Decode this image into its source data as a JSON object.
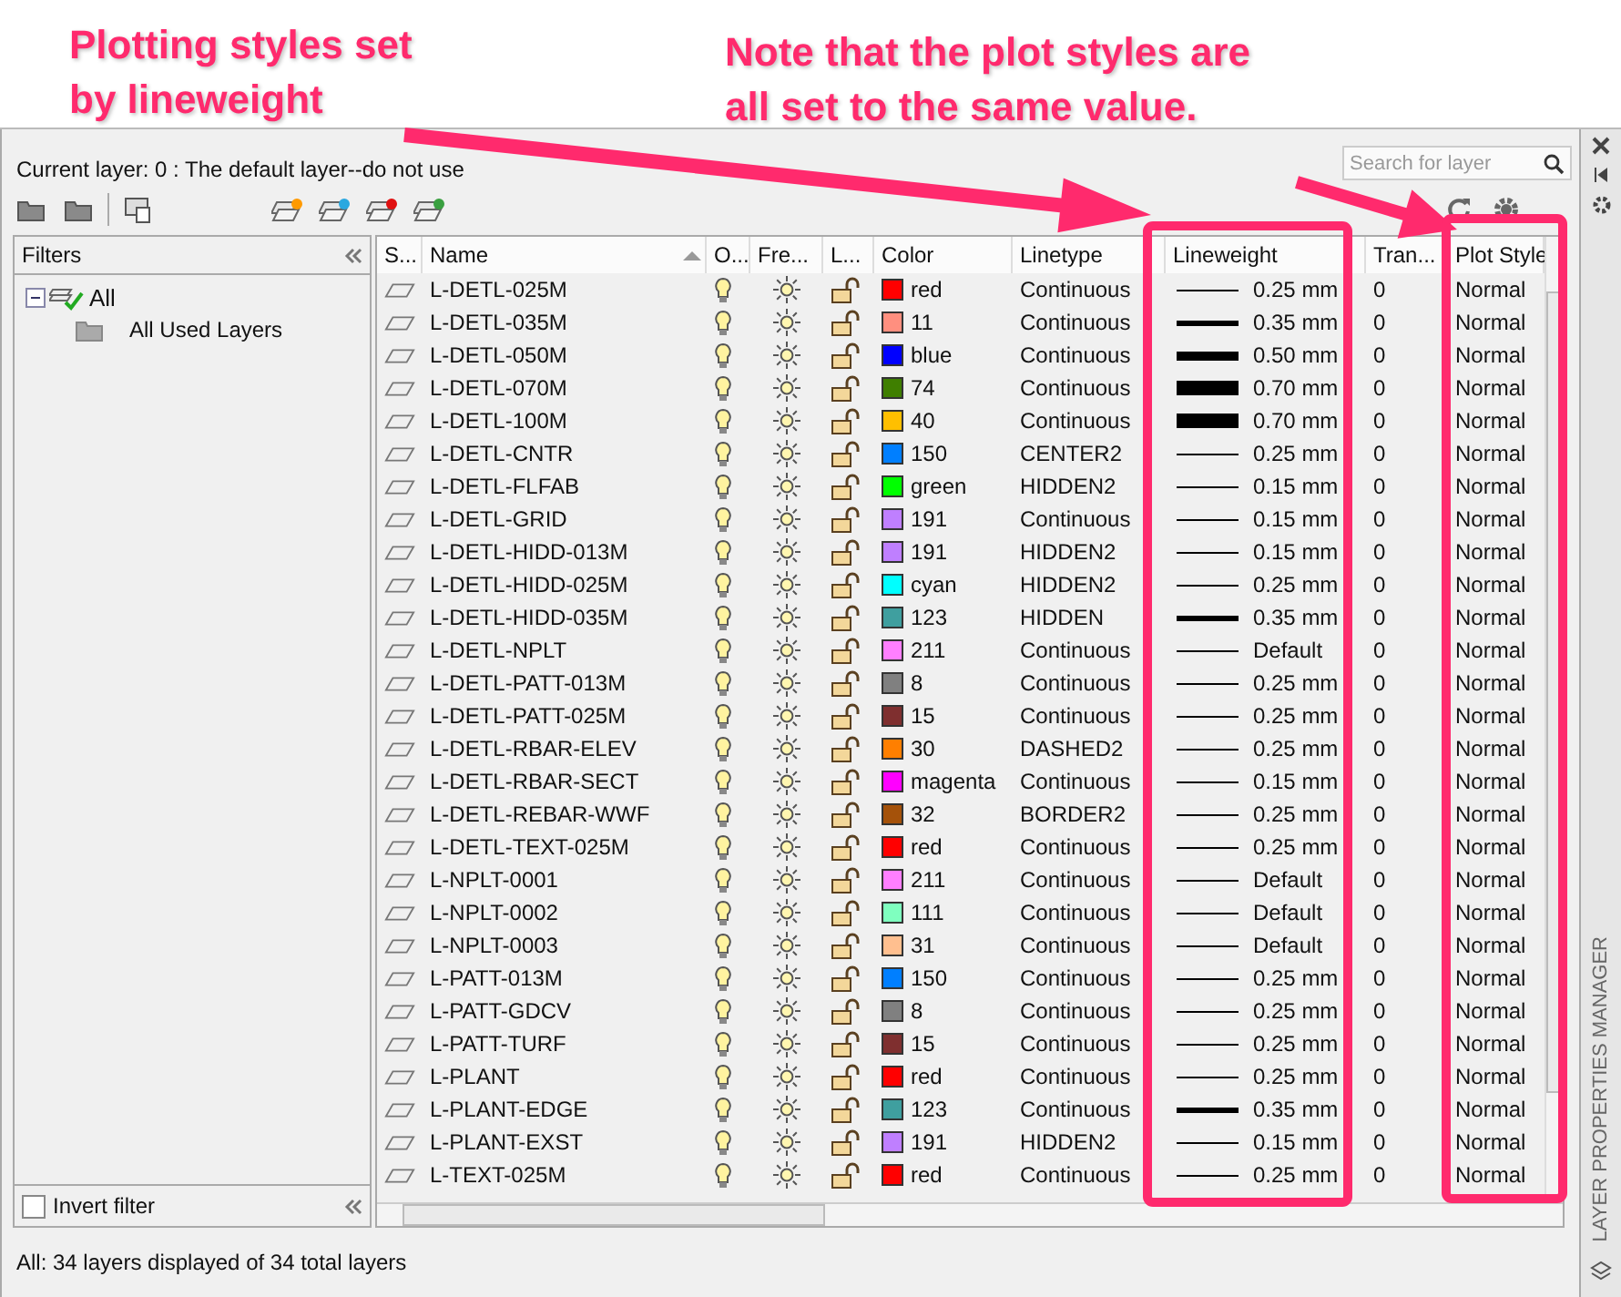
{
  "annotations": [
    {
      "text": "Plotting styles set\nby lineweight"
    },
    {
      "text": "Note that the plot styles are\nall set to the same value."
    }
  ],
  "current_layer": "Current layer: 0 : The default layer--do not use",
  "search": {
    "placeholder": "Search for layer"
  },
  "filters": {
    "title": "Filters",
    "tree": [
      {
        "label": "All",
        "expanded": true,
        "children": [
          {
            "label": "All Used Layers"
          }
        ]
      }
    ],
    "invert_filter": {
      "label": "Invert filter",
      "checked": false
    }
  },
  "table": {
    "columns": [
      {
        "label": "S..."
      },
      {
        "label": "Name",
        "sorted": true
      },
      {
        "label": "O..."
      },
      {
        "label": "Fre..."
      },
      {
        "label": "L..."
      },
      {
        "label": "Color"
      },
      {
        "label": "Linetype"
      },
      {
        "label": "Lineweight"
      },
      {
        "label": "Tran..."
      },
      {
        "label": "Plot Style"
      }
    ],
    "rows": [
      {
        "name": "L-DETL-025M",
        "on": true,
        "frozen": false,
        "locked": false,
        "color": "#ff0000",
        "color_name": "red",
        "linetype": "Continuous",
        "kind": "thin",
        "lineweight": "0.25 mm",
        "transparency": "0",
        "plot_style": "Normal"
      },
      {
        "name": "L-DETL-035M",
        "on": true,
        "frozen": false,
        "locked": false,
        "color": "#ff8f7f",
        "color_name": "11",
        "linetype": "Continuous",
        "kind": "medium",
        "lineweight": "0.35 mm",
        "transparency": "0",
        "plot_style": "Normal"
      },
      {
        "name": "L-DETL-050M",
        "on": true,
        "frozen": false,
        "locked": false,
        "color": "#0000ff",
        "color_name": "blue",
        "linetype": "Continuous",
        "kind": "bold",
        "lineweight": "0.50 mm",
        "transparency": "0",
        "plot_style": "Normal"
      },
      {
        "name": "L-DETL-070M",
        "on": true,
        "frozen": false,
        "locked": false,
        "color": "#3f7f00",
        "color_name": "74",
        "linetype": "Continuous",
        "kind": "heavy",
        "lineweight": "0.70 mm",
        "transparency": "0",
        "plot_style": "Normal"
      },
      {
        "name": "L-DETL-100M",
        "on": true,
        "frozen": false,
        "locked": false,
        "color": "#ffbf00",
        "color_name": "40",
        "linetype": "Continuous",
        "kind": "heavy",
        "lineweight": "0.70 mm",
        "transparency": "0",
        "plot_style": "Normal"
      },
      {
        "name": "L-DETL-CNTR",
        "on": true,
        "frozen": false,
        "locked": false,
        "color": "#007fff",
        "color_name": "150",
        "linetype": "CENTER2",
        "kind": "thin",
        "lineweight": "0.25 mm",
        "transparency": "0",
        "plot_style": "Normal"
      },
      {
        "name": "L-DETL-FLFAB",
        "on": true,
        "frozen": false,
        "locked": false,
        "color": "#00ff00",
        "color_name": "green",
        "linetype": "HIDDEN2",
        "kind": "thin",
        "lineweight": "0.15 mm",
        "transparency": "0",
        "plot_style": "Normal"
      },
      {
        "name": "L-DETL-GRID",
        "on": true,
        "frozen": false,
        "locked": false,
        "color": "#bf7fff",
        "color_name": "191",
        "linetype": "Continuous",
        "kind": "thin",
        "lineweight": "0.15 mm",
        "transparency": "0",
        "plot_style": "Normal"
      },
      {
        "name": "L-DETL-HIDD-013M",
        "on": true,
        "frozen": false,
        "locked": false,
        "color": "#bf7fff",
        "color_name": "191",
        "linetype": "HIDDEN2",
        "kind": "thin",
        "lineweight": "0.15 mm",
        "transparency": "0",
        "plot_style": "Normal"
      },
      {
        "name": "L-DETL-HIDD-025M",
        "on": true,
        "frozen": false,
        "locked": false,
        "color": "#00ffff",
        "color_name": "cyan",
        "linetype": "HIDDEN2",
        "kind": "thin",
        "lineweight": "0.25 mm",
        "transparency": "0",
        "plot_style": "Normal"
      },
      {
        "name": "L-DETL-HIDD-035M",
        "on": true,
        "frozen": false,
        "locked": false,
        "color": "#3f9f9f",
        "color_name": "123",
        "linetype": "HIDDEN",
        "kind": "medium",
        "lineweight": "0.35 mm",
        "transparency": "0",
        "plot_style": "Normal"
      },
      {
        "name": "L-DETL-NPLT",
        "on": true,
        "frozen": false,
        "locked": false,
        "color": "#ff7fff",
        "color_name": "211",
        "linetype": "Continuous",
        "kind": "thin",
        "lineweight": "Default",
        "transparency": "0",
        "plot_style": "Normal"
      },
      {
        "name": "L-DETL-PATT-013M",
        "on": true,
        "frozen": false,
        "locked": false,
        "color": "#808080",
        "color_name": "8",
        "linetype": "Continuous",
        "kind": "thin",
        "lineweight": "0.25 mm",
        "transparency": "0",
        "plot_style": "Normal"
      },
      {
        "name": "L-DETL-PATT-025M",
        "on": true,
        "frozen": false,
        "locked": false,
        "color": "#7f2f2f",
        "color_name": "15",
        "linetype": "Continuous",
        "kind": "thin",
        "lineweight": "0.25 mm",
        "transparency": "0",
        "plot_style": "Normal"
      },
      {
        "name": "L-DETL-RBAR-ELEV",
        "on": true,
        "frozen": false,
        "locked": false,
        "color": "#ff7f00",
        "color_name": "30",
        "linetype": "DASHED2",
        "kind": "thin",
        "lineweight": "0.25 mm",
        "transparency": "0",
        "plot_style": "Normal"
      },
      {
        "name": "L-DETL-RBAR-SECT",
        "on": true,
        "frozen": false,
        "locked": false,
        "color": "#ff00ff",
        "color_name": "magenta",
        "linetype": "Continuous",
        "kind": "thin",
        "lineweight": "0.15 mm",
        "transparency": "0",
        "plot_style": "Normal"
      },
      {
        "name": "L-DETL-REBAR-WWF",
        "on": true,
        "frozen": false,
        "locked": false,
        "color": "#a5520a",
        "color_name": "32",
        "linetype": "BORDER2",
        "kind": "thin",
        "lineweight": "0.25 mm",
        "transparency": "0",
        "plot_style": "Normal"
      },
      {
        "name": "L-DETL-TEXT-025M",
        "on": true,
        "frozen": false,
        "locked": false,
        "color": "#ff0000",
        "color_name": "red",
        "linetype": "Continuous",
        "kind": "thin",
        "lineweight": "0.25 mm",
        "transparency": "0",
        "plot_style": "Normal"
      },
      {
        "name": "L-NPLT-0001",
        "on": true,
        "frozen": false,
        "locked": false,
        "color": "#ff7fff",
        "color_name": "211",
        "linetype": "Continuous",
        "kind": "thin",
        "lineweight": "Default",
        "transparency": "0",
        "plot_style": "Normal"
      },
      {
        "name": "L-NPLT-0002",
        "on": true,
        "frozen": false,
        "locked": false,
        "color": "#7fffbf",
        "color_name": "111",
        "linetype": "Continuous",
        "kind": "thin",
        "lineweight": "Default",
        "transparency": "0",
        "plot_style": "Normal"
      },
      {
        "name": "L-NPLT-0003",
        "on": true,
        "frozen": false,
        "locked": false,
        "color": "#ffbf8f",
        "color_name": "31",
        "linetype": "Continuous",
        "kind": "thin",
        "lineweight": "Default",
        "transparency": "0",
        "plot_style": "Normal"
      },
      {
        "name": "L-PATT-013M",
        "on": true,
        "frozen": false,
        "locked": false,
        "color": "#007fff",
        "color_name": "150",
        "linetype": "Continuous",
        "kind": "thin",
        "lineweight": "0.25 mm",
        "transparency": "0",
        "plot_style": "Normal"
      },
      {
        "name": "L-PATT-GDCV",
        "on": true,
        "frozen": false,
        "locked": false,
        "color": "#808080",
        "color_name": "8",
        "linetype": "Continuous",
        "kind": "thin",
        "lineweight": "0.25 mm",
        "transparency": "0",
        "plot_style": "Normal"
      },
      {
        "name": "L-PATT-TURF",
        "on": true,
        "frozen": false,
        "locked": false,
        "color": "#7f2f2f",
        "color_name": "15",
        "linetype": "Continuous",
        "kind": "thin",
        "lineweight": "0.25 mm",
        "transparency": "0",
        "plot_style": "Normal"
      },
      {
        "name": "L-PLANT",
        "on": true,
        "frozen": false,
        "locked": false,
        "color": "#ff0000",
        "color_name": "red",
        "linetype": "Continuous",
        "kind": "thin",
        "lineweight": "0.25 mm",
        "transparency": "0",
        "plot_style": "Normal"
      },
      {
        "name": "L-PLANT-EDGE",
        "on": true,
        "frozen": false,
        "locked": false,
        "color": "#3f9f9f",
        "color_name": "123",
        "linetype": "Continuous",
        "kind": "medium",
        "lineweight": "0.35 mm",
        "transparency": "0",
        "plot_style": "Normal"
      },
      {
        "name": "L-PLANT-EXST",
        "on": true,
        "frozen": false,
        "locked": false,
        "color": "#bf7fff",
        "color_name": "191",
        "linetype": "HIDDEN2",
        "kind": "thin",
        "lineweight": "0.15 mm",
        "transparency": "0",
        "plot_style": "Normal"
      },
      {
        "name": "L-TEXT-025M",
        "on": true,
        "frozen": false,
        "locked": false,
        "color": "#ff0000",
        "color_name": "red",
        "linetype": "Continuous",
        "kind": "thin",
        "lineweight": "0.25 mm",
        "transparency": "0",
        "plot_style": "Normal"
      }
    ]
  },
  "status_bar": "All: 34 layers displayed of 34 total layers",
  "side_title": "LAYER PROPERTIES MANAGER"
}
